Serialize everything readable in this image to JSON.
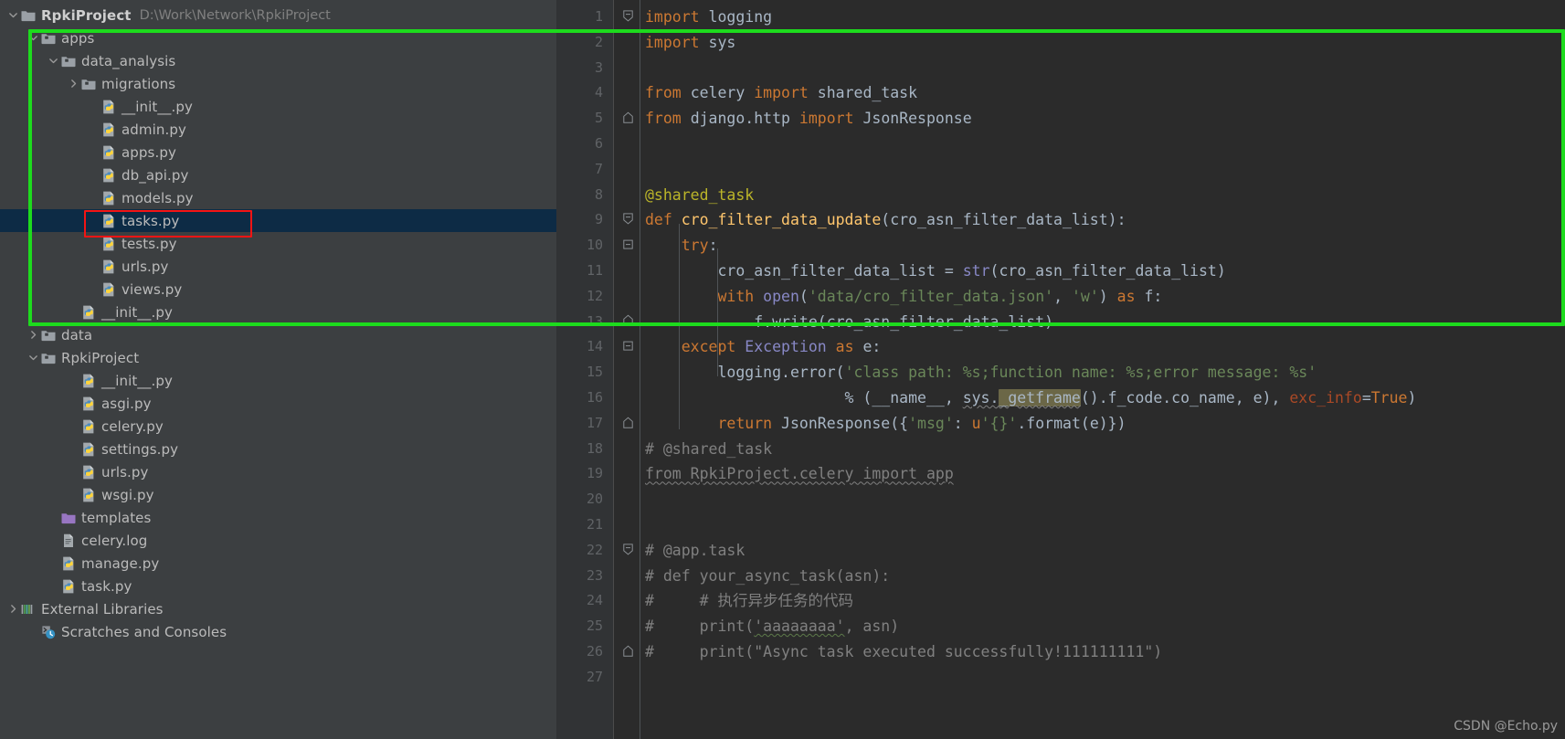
{
  "project": {
    "name": "RpkiProject",
    "path": "D:\\Work\\Network\\RpkiProject"
  },
  "tree": [
    {
      "label": "RpkiProject",
      "path": "D:\\Work\\Network\\RpkiProject",
      "icon": "folder-project-icon",
      "arrow": "chevron-down-icon",
      "indent": 0,
      "bold": true,
      "selected": false
    },
    {
      "label": "apps",
      "path": "",
      "icon": "folder-module-icon",
      "arrow": "chevron-down-icon",
      "indent": 1,
      "bold": false,
      "selected": false
    },
    {
      "label": "data_analysis",
      "path": "",
      "icon": "folder-module-icon",
      "arrow": "chevron-down-icon",
      "indent": 2,
      "bold": false,
      "selected": false
    },
    {
      "label": "migrations",
      "path": "",
      "icon": "folder-module-icon",
      "arrow": "chevron-right-icon",
      "indent": 3,
      "bold": false,
      "selected": false
    },
    {
      "label": "__init__.py",
      "path": "",
      "icon": "python-file-icon",
      "arrow": "none",
      "indent": 4,
      "bold": false,
      "selected": false
    },
    {
      "label": "admin.py",
      "path": "",
      "icon": "python-file-icon",
      "arrow": "none",
      "indent": 4,
      "bold": false,
      "selected": false
    },
    {
      "label": "apps.py",
      "path": "",
      "icon": "python-file-icon",
      "arrow": "none",
      "indent": 4,
      "bold": false,
      "selected": false
    },
    {
      "label": "db_api.py",
      "path": "",
      "icon": "python-file-icon",
      "arrow": "none",
      "indent": 4,
      "bold": false,
      "selected": false
    },
    {
      "label": "models.py",
      "path": "",
      "icon": "python-file-icon",
      "arrow": "none",
      "indent": 4,
      "bold": false,
      "selected": false
    },
    {
      "label": "tasks.py",
      "path": "",
      "icon": "python-file-icon",
      "arrow": "none",
      "indent": 4,
      "bold": false,
      "selected": true
    },
    {
      "label": "tests.py",
      "path": "",
      "icon": "python-file-icon",
      "arrow": "none",
      "indent": 4,
      "bold": false,
      "selected": false
    },
    {
      "label": "urls.py",
      "path": "",
      "icon": "python-file-icon",
      "arrow": "none",
      "indent": 4,
      "bold": false,
      "selected": false
    },
    {
      "label": "views.py",
      "path": "",
      "icon": "python-file-icon",
      "arrow": "none",
      "indent": 4,
      "bold": false,
      "selected": false
    },
    {
      "label": "__init__.py",
      "path": "",
      "icon": "python-file-icon",
      "arrow": "none",
      "indent": 3,
      "bold": false,
      "selected": false
    },
    {
      "label": "data",
      "path": "",
      "icon": "folder-module-icon",
      "arrow": "chevron-right-icon",
      "indent": 1,
      "bold": false,
      "selected": false
    },
    {
      "label": "RpkiProject",
      "path": "",
      "icon": "folder-module-icon",
      "arrow": "chevron-down-icon",
      "indent": 1,
      "bold": false,
      "selected": false
    },
    {
      "label": "__init__.py",
      "path": "",
      "icon": "python-file-icon",
      "arrow": "none",
      "indent": 3,
      "bold": false,
      "selected": false
    },
    {
      "label": "asgi.py",
      "path": "",
      "icon": "python-file-icon",
      "arrow": "none",
      "indent": 3,
      "bold": false,
      "selected": false
    },
    {
      "label": "celery.py",
      "path": "",
      "icon": "python-file-icon",
      "arrow": "none",
      "indent": 3,
      "bold": false,
      "selected": false
    },
    {
      "label": "settings.py",
      "path": "",
      "icon": "python-file-icon",
      "arrow": "none",
      "indent": 3,
      "bold": false,
      "selected": false
    },
    {
      "label": "urls.py",
      "path": "",
      "icon": "python-file-icon",
      "arrow": "none",
      "indent": 3,
      "bold": false,
      "selected": false
    },
    {
      "label": "wsgi.py",
      "path": "",
      "icon": "python-file-icon",
      "arrow": "none",
      "indent": 3,
      "bold": false,
      "selected": false
    },
    {
      "label": "templates",
      "path": "",
      "icon": "folder-templates-icon",
      "arrow": "none",
      "indent": 2,
      "bold": false,
      "selected": false
    },
    {
      "label": "celery.log",
      "path": "",
      "icon": "log-file-icon",
      "arrow": "none",
      "indent": 2,
      "bold": false,
      "selected": false
    },
    {
      "label": "manage.py",
      "path": "",
      "icon": "python-file-icon",
      "arrow": "none",
      "indent": 2,
      "bold": false,
      "selected": false
    },
    {
      "label": "task.py",
      "path": "",
      "icon": "python-file-icon",
      "arrow": "none",
      "indent": 2,
      "bold": false,
      "selected": false
    },
    {
      "label": "External Libraries",
      "path": "",
      "icon": "external-libraries-icon",
      "arrow": "chevron-right-icon",
      "indent": 0,
      "bold": false,
      "selected": false
    },
    {
      "label": "Scratches and Consoles",
      "path": "",
      "icon": "scratches-icon",
      "arrow": "none",
      "indent": 1,
      "bold": false,
      "selected": false
    }
  ],
  "editor": {
    "line_numbers": [
      "1",
      "2",
      "3",
      "4",
      "5",
      "6",
      "7",
      "8",
      "9",
      "10",
      "11",
      "12",
      "13",
      "14",
      "15",
      "16",
      "17",
      "18",
      "19",
      "20",
      "21",
      "22",
      "23",
      "24",
      "25",
      "26",
      "27"
    ],
    "lines": [
      "import logging",
      "import sys",
      "",
      "from celery import shared_task",
      "from django.http import JsonResponse",
      "",
      "",
      "@shared_task",
      "def cro_filter_data_update(cro_asn_filter_data_list):",
      "    try:",
      "        cro_asn_filter_data_list = str(cro_asn_filter_data_list)",
      "        with open('data/cro_filter_data.json', 'w') as f:",
      "            f.write(cro_asn_filter_data_list)",
      "    except Exception as e:",
      "        logging.error('class path: %s;function name: %s;error message: %s'",
      "                      % (__name__, sys._getframe().f_code.co_name, e), exc_info=True)",
      "        return JsonResponse({'msg': u'{}'.format(e)})",
      "# @shared_task",
      "from RpkiProject.celery import app",
      "",
      "",
      "# @app.task",
      "# def your_async_task(asn):",
      "#     # 执行异步任务的代码",
      "#     print('aaaaaaaa', asn)",
      "#     print(\"Async task executed successfully!111111111\")",
      ""
    ]
  },
  "annotations": {
    "green_box_color": "#1ddb1d",
    "red_box_color": "#f41414",
    "selected_row_color": "#0d2b45"
  },
  "watermark": "CSDN @Echo.py",
  "theme": {
    "sidebar_bg": "#3c3f41",
    "editor_bg": "#2b2b2b",
    "gutter_bg": "#313335",
    "keyword": "#cc7832",
    "string": "#6a8759",
    "function": "#ffc66d",
    "decorator": "#bbb529",
    "builtin": "#8888c6",
    "comment": "#808080",
    "text": "#a9b7c6",
    "kwarg": "#aa4926"
  }
}
